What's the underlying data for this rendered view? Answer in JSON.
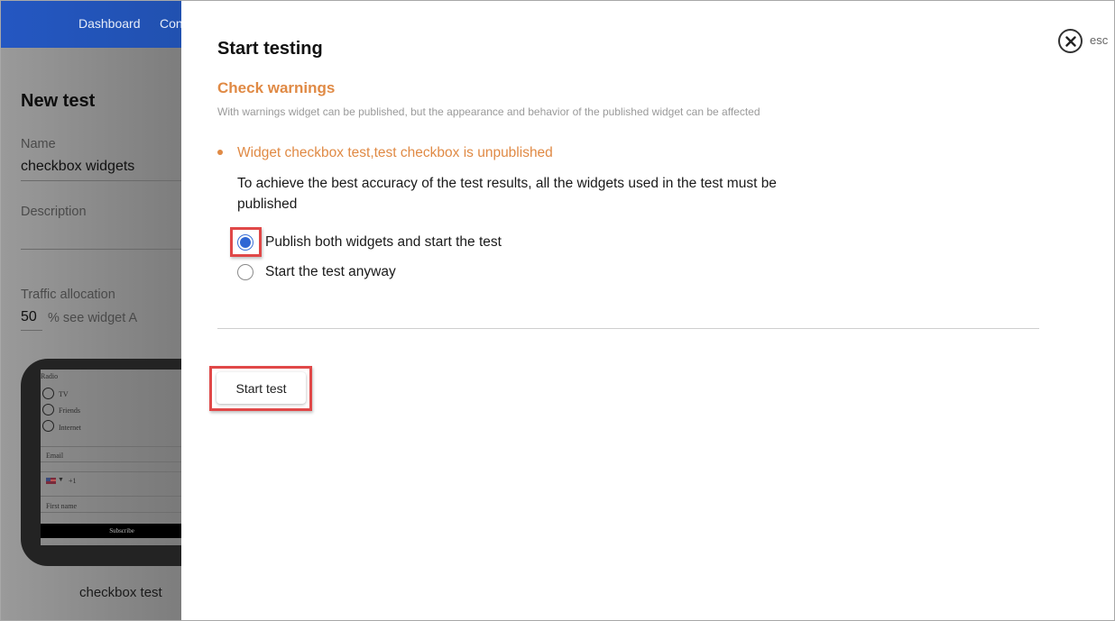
{
  "background": {
    "nav": {
      "items": [
        {
          "label": "Dashboard"
        },
        {
          "label": "Con"
        }
      ]
    },
    "page_title": "New test",
    "form": {
      "name_label": "Name",
      "name_value": "checkbox widgets",
      "description_label": "Description",
      "description_value": "",
      "traffic_label": "Traffic allocation",
      "traffic_value": "50",
      "traffic_suffix": "% see widget A"
    },
    "preview": {
      "group_label": "Radio",
      "options": [
        "TV",
        "Friends",
        "Internet"
      ],
      "email_placeholder": "Email",
      "phone_prefix": "+1",
      "firstname_placeholder": "First name",
      "subscribe_label": "Subscribe",
      "caption": "checkbox test"
    }
  },
  "modal": {
    "title": "Start testing",
    "close_icon": "close-circle-icon",
    "esc_label": "esc",
    "section_title": "Check warnings",
    "section_subtitle": "With warnings widget can be published, but the appearance and behavior of the published widget can be affected",
    "warning": {
      "title": "Widget checkbox test,test checkbox is unpublished",
      "description": "To achieve the best accuracy of the test results, all the widgets used in the test must be published"
    },
    "options": [
      {
        "label": "Publish both widgets and start the test",
        "selected": true
      },
      {
        "label": "Start the test anyway",
        "selected": false
      }
    ],
    "start_button_label": "Start test"
  },
  "colors": {
    "accent_orange": "#e08a45",
    "radio_blue": "#2f66d4",
    "nav_blue": "#2457c2",
    "highlight_red": "#e04848"
  }
}
